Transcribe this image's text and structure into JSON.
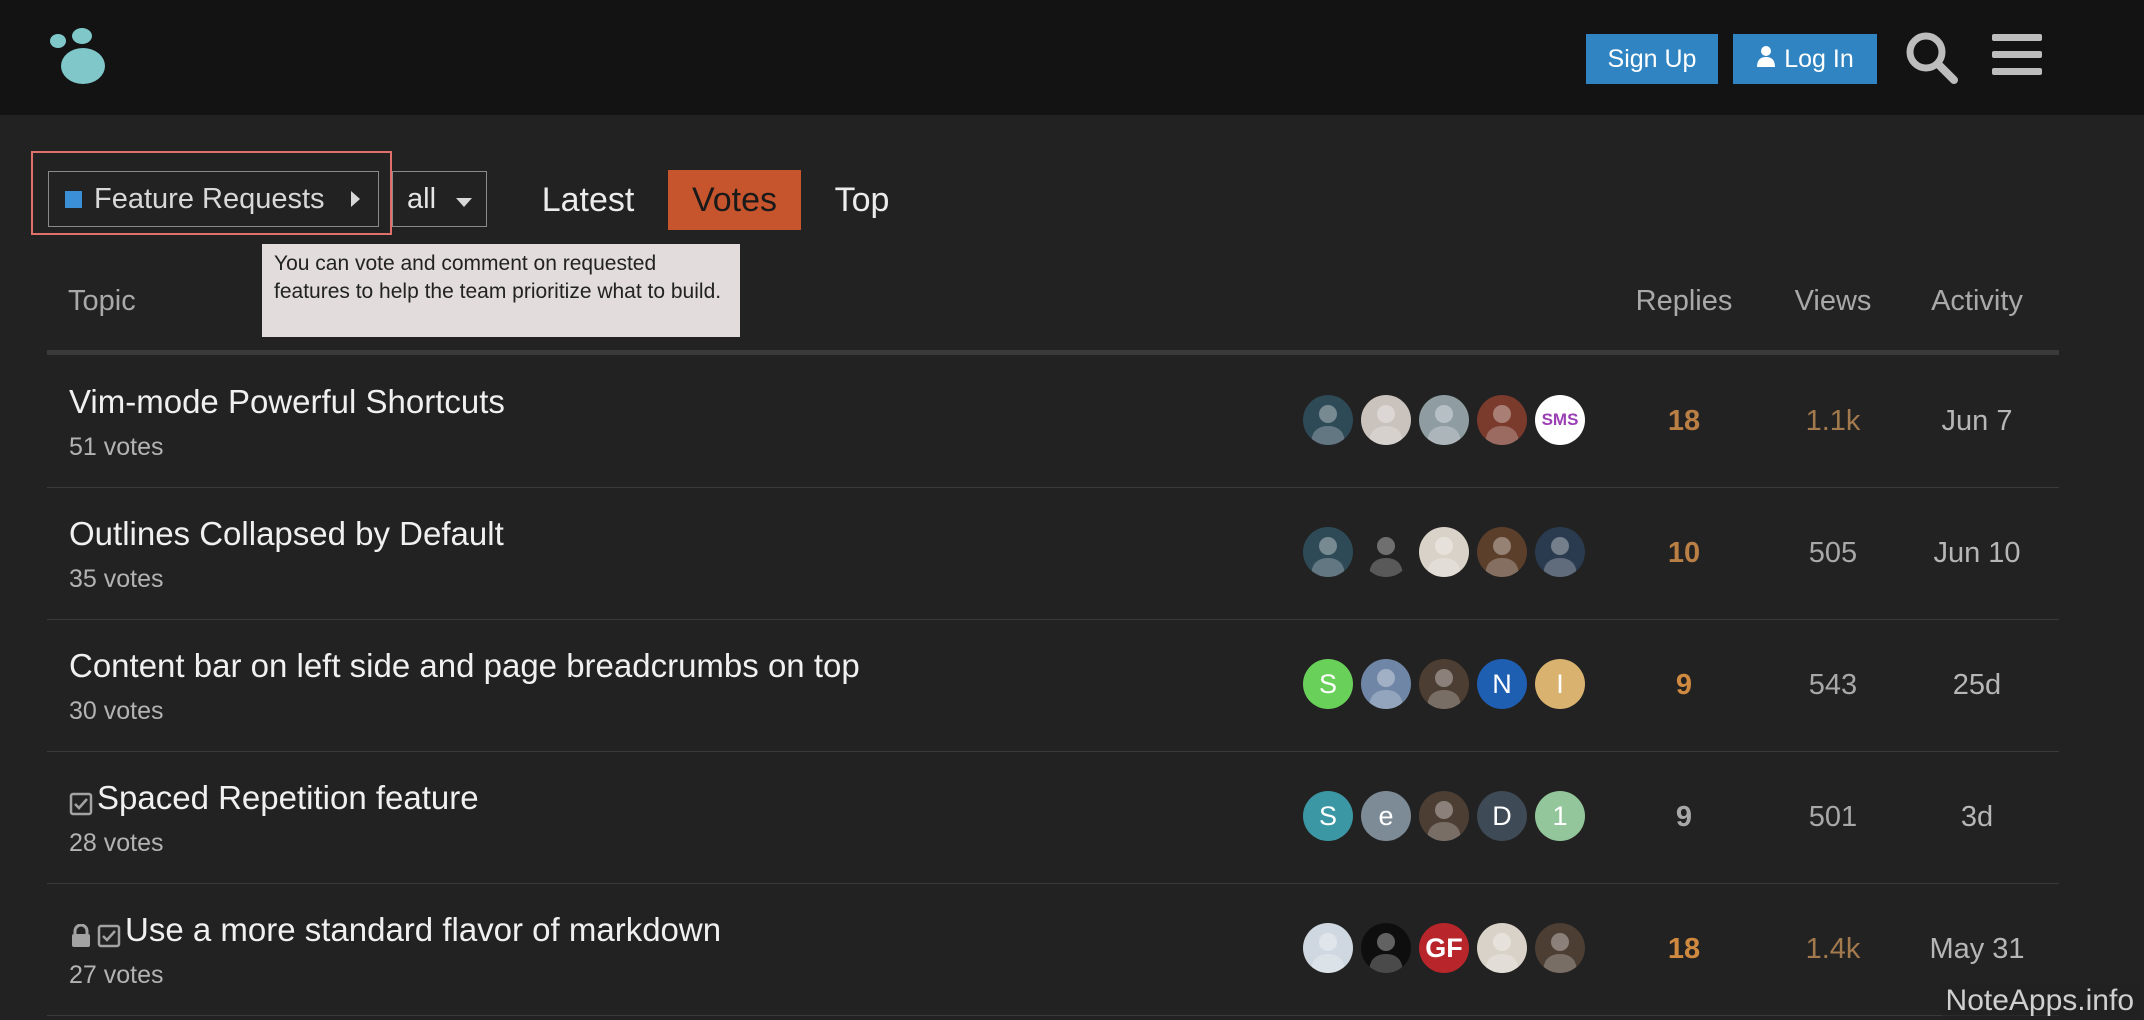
{
  "header": {
    "signup_label": "Sign Up",
    "login_label": "Log In"
  },
  "filters": {
    "category": "Feature Requests",
    "category_color": "#3a8fd6",
    "subcategory": "all",
    "tabs": [
      {
        "label": "Latest",
        "active": false
      },
      {
        "label": "Votes",
        "active": true
      },
      {
        "label": "Top",
        "active": false
      }
    ],
    "active_tab_color": "#c6542c"
  },
  "tooltip": {
    "text": "You can vote and comment on requested features to help the team prioritize what to build."
  },
  "table": {
    "headers": {
      "topic": "Topic",
      "replies": "Replies",
      "views": "Views",
      "activity": "Activity"
    },
    "rows": [
      {
        "title": "Vim-mode Powerful Shortcuts",
        "votes": "51 votes",
        "locked": false,
        "solved": false,
        "replies": "18",
        "replies_color": "#b97f45",
        "views": "1.1k",
        "views_color": "#a27a4e",
        "activity": "Jun 7",
        "posters": [
          {
            "icon": "avatar-person-dark",
            "bg": "#2e4a57"
          },
          {
            "icon": "avatar-rabbit",
            "bg": "#c9c2bd"
          },
          {
            "icon": "avatar-person-glasses",
            "bg": "#8f9da3"
          },
          {
            "icon": "avatar-person-red",
            "bg": "#7a3a2c"
          },
          {
            "text": "SMS",
            "bg": "#ffffff",
            "fg": "#9b3fb5"
          }
        ]
      },
      {
        "title": "Outlines Collapsed by Default",
        "votes": "35 votes",
        "locked": false,
        "solved": false,
        "replies": "10",
        "replies_color": "#b97f45",
        "views": "505",
        "views_color": "#a8a8a8",
        "activity": "Jun 10",
        "posters": [
          {
            "icon": "avatar-person-dark",
            "bg": "#2e4a57"
          },
          {
            "icon": "avatar-figure-black",
            "bg": "#222222"
          },
          {
            "icon": "avatar-person-woman",
            "bg": "#d9d2c8"
          },
          {
            "icon": "avatar-person-beard",
            "bg": "#5c3f2b"
          },
          {
            "icon": "avatar-person-glasses-beard",
            "bg": "#2b3b4f"
          }
        ]
      },
      {
        "title": "Content bar on left side and page breadcrumbs on top",
        "votes": "30 votes",
        "locked": false,
        "solved": false,
        "replies": "9",
        "replies_color": "#d08a40",
        "views": "543",
        "views_color": "#a8a8a8",
        "activity": "25d",
        "posters": [
          {
            "text": "S",
            "bg": "#69d15a",
            "fg": "#ffffff"
          },
          {
            "icon": "avatar-person-smile",
            "bg": "#6f86a7"
          },
          {
            "icon": "avatar-group",
            "bg": "#4d3e33"
          },
          {
            "text": "N",
            "bg": "#1f5fb2",
            "fg": "#ffffff"
          },
          {
            "text": "I",
            "bg": "#d8b26e",
            "fg": "#ffffff"
          }
        ]
      },
      {
        "title": "Spaced Repetition feature",
        "votes": "28 votes",
        "locked": false,
        "solved": true,
        "replies": "9",
        "replies_color": "#a8a8a8",
        "views": "501",
        "views_color": "#a8a8a8",
        "activity": "3d",
        "posters": [
          {
            "text": "S",
            "bg": "#3b97a3",
            "fg": "#ffffff"
          },
          {
            "text": "e",
            "bg": "#7c8b96",
            "fg": "#ffffff"
          },
          {
            "icon": "avatar-group",
            "bg": "#4d3e33"
          },
          {
            "text": "D",
            "bg": "#3e4a55",
            "fg": "#ffffff"
          },
          {
            "text": "1",
            "bg": "#93c79b",
            "fg": "#ffffff"
          }
        ]
      },
      {
        "title": "Use a more standard flavor of markdown",
        "votes": "27 votes",
        "locked": true,
        "solved": true,
        "replies": "18",
        "replies_color": "#d08a40",
        "views": "1.4k",
        "views_color": "#a27a4e",
        "activity": "May 31",
        "posters": [
          {
            "icon": "avatar-person-white-shirt",
            "bg": "#cfd8e0"
          },
          {
            "icon": "avatar-red-dash",
            "bg": "#0e0e0e"
          },
          {
            "text": "GF",
            "bg": "#b8262b",
            "fg": "#ffffff"
          },
          {
            "icon": "avatar-person-woman",
            "bg": "#d9d2c8"
          },
          {
            "icon": "avatar-group",
            "bg": "#4d3e33"
          }
        ]
      }
    ]
  },
  "watermark": "NoteApps.info"
}
